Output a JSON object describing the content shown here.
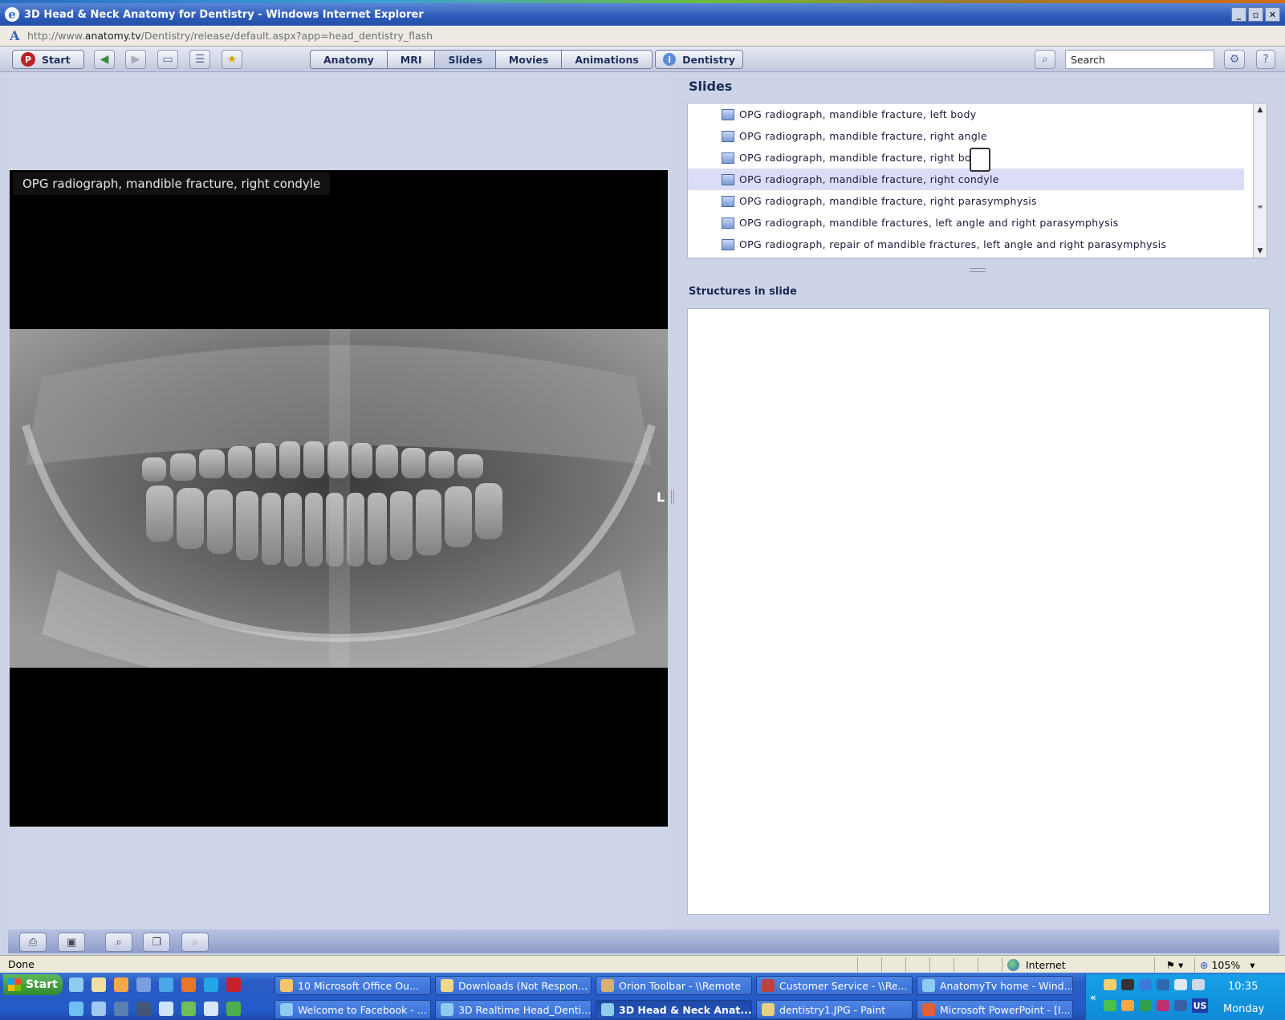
{
  "browser": {
    "title": "3D Head & Neck Anatomy for Dentistry - Windows Internet Explorer",
    "url_prefix": "http://www.",
    "url_domain": "anatomy.tv",
    "url_path": "/Dentistry/release/default.aspx?app=head_dentistry_flash",
    "window_buttons": [
      "_",
      "▫",
      "✕"
    ]
  },
  "toolbar": {
    "start_label": "Start",
    "tabs": [
      {
        "label": "Anatomy"
      },
      {
        "label": "MRI"
      },
      {
        "label": "Slides",
        "selected": true
      },
      {
        "label": "Movies"
      },
      {
        "label": "Animations"
      }
    ],
    "dentistry_label": "Dentistry",
    "search_placeholder": "Search"
  },
  "viewer": {
    "caption": "OPG radiograph, mandible fracture, right condyle",
    "orientation_label": "L"
  },
  "slides_panel": {
    "title": "Slides",
    "items": [
      {
        "label": "OPG radiograph, mandible fracture, left body"
      },
      {
        "label": "OPG radiograph, mandible fracture, right angle"
      },
      {
        "label": "OPG radiograph, mandible fracture, right body"
      },
      {
        "label": "OPG radiograph, mandible fracture, right condyle",
        "selected": true
      },
      {
        "label": "OPG radiograph, mandible fracture, right parasymphysis"
      },
      {
        "label": "OPG radiograph, mandible fractures, left angle and right parasymphysis"
      },
      {
        "label": "OPG radiograph, repair of mandible fractures, left angle and right parasymphysis"
      }
    ]
  },
  "structures_panel": {
    "title": "Structures in slide"
  },
  "statusbar": {
    "status": "Done",
    "zone": "Internet",
    "zoom": "105%"
  },
  "taskbar": {
    "start_label": "Start",
    "tasks_row1": [
      {
        "label": "10 Microsoft Office Ou..."
      },
      {
        "label": "Downloads (Not Respon..."
      },
      {
        "label": "Orion Toolbar - \\\\Remote"
      },
      {
        "label": "Customer Service - \\\\Re..."
      },
      {
        "label": "AnatomyTv home - Wind..."
      }
    ],
    "tasks_row2": [
      {
        "label": "Welcome to Facebook - ..."
      },
      {
        "label": "3D Realtime Head_Denti..."
      },
      {
        "label": "3D Head & Neck Anat...",
        "active": true
      },
      {
        "label": "dentistry1.JPG - Paint"
      },
      {
        "label": "Microsoft PowerPoint - [I..."
      }
    ],
    "clock_time": "10:35",
    "clock_day": "Monday",
    "lang": "US"
  }
}
